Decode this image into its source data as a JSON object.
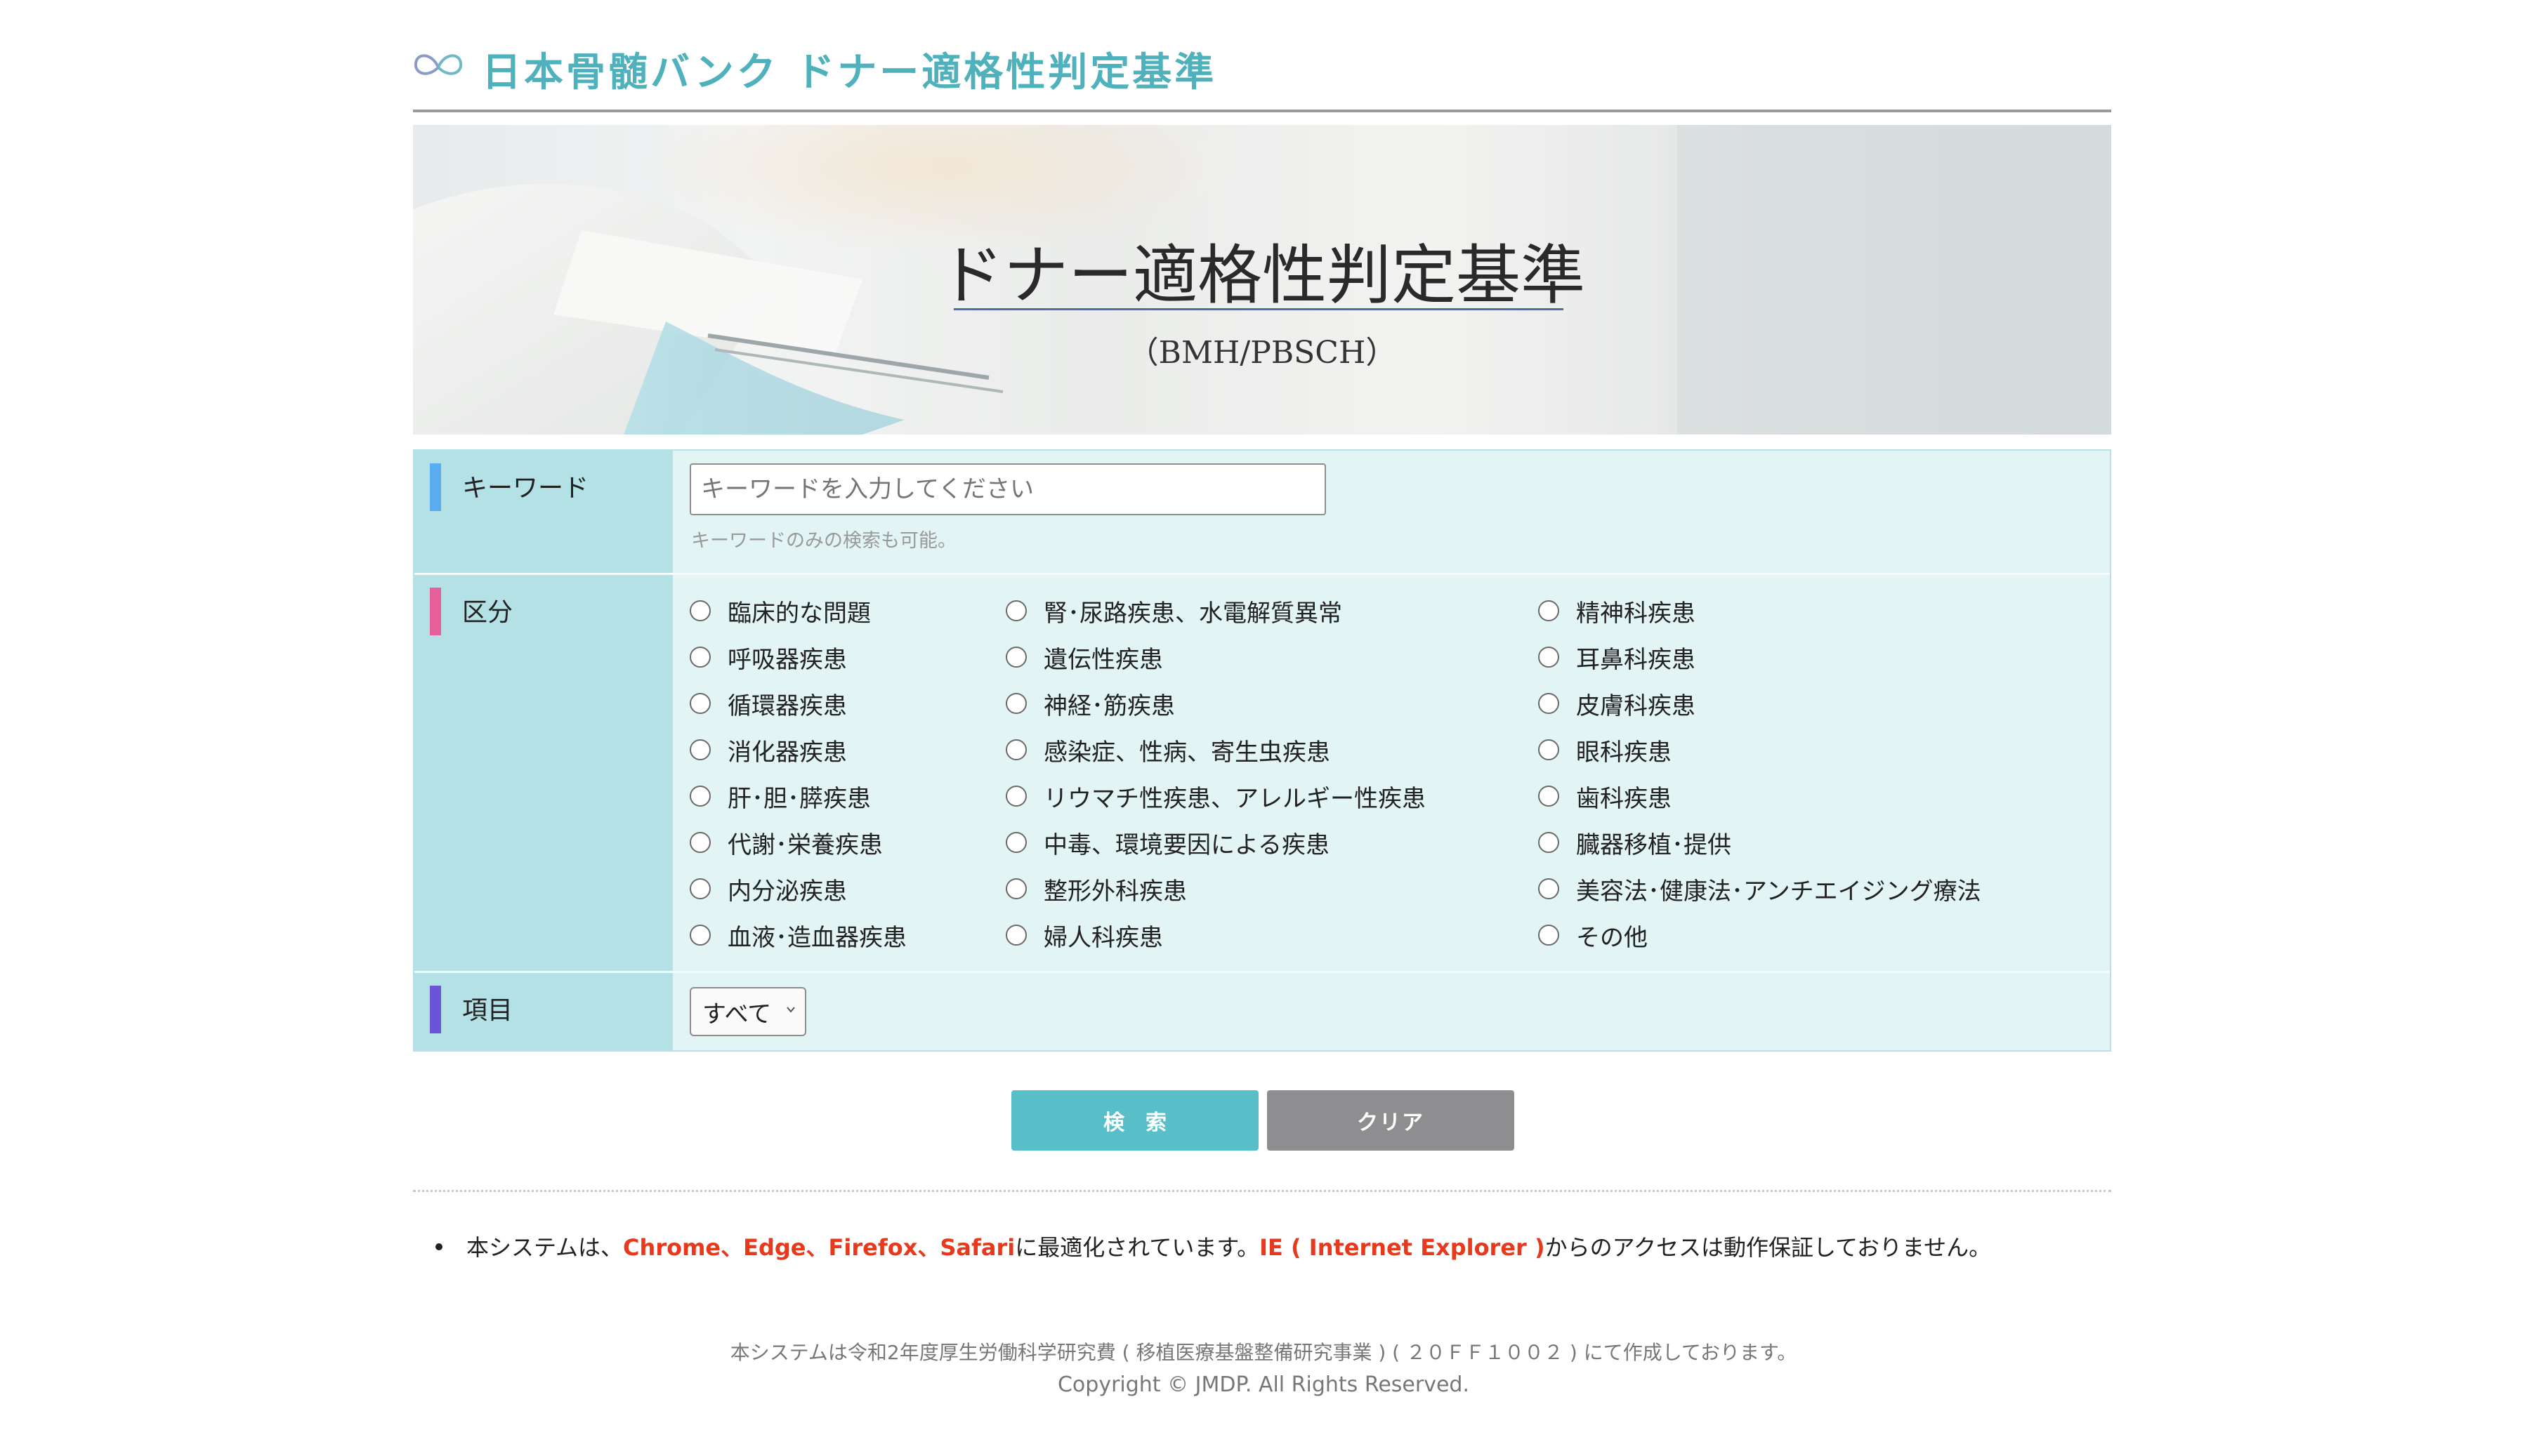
{
  "header": {
    "site_title": "日本骨髄バンク ドナー適格性判定基準"
  },
  "hero": {
    "title": "ドナー適格性判定基準",
    "subtitle": "（BMH/PBSCH）"
  },
  "form": {
    "keyword": {
      "label": "キーワード",
      "placeholder": "キーワードを入力してください",
      "value": "",
      "hint": "キーワードのみの検索も可能。"
    },
    "category": {
      "label": "区分",
      "col1": [
        "臨床的な問題",
        "呼吸器疾患",
        "循環器疾患",
        "消化器疾患",
        "肝･胆･膵疾患",
        "代謝･栄養疾患",
        "内分泌疾患",
        "血液･造血器疾患"
      ],
      "col2": [
        "腎･尿路疾患、水電解質異常",
        "遺伝性疾患",
        "神経･筋疾患",
        "感染症、性病、寄生虫疾患",
        "リウマチ性疾患、アレルギー性疾患",
        "中毒、環境要因による疾患",
        "整形外科疾患",
        "婦人科疾患"
      ],
      "col3": [
        "精神科疾患",
        "耳鼻科疾患",
        "皮膚科疾患",
        "眼科疾患",
        "歯科疾患",
        "臓器移植･提供",
        "美容法･健康法･アンチエイジング療法",
        "その他"
      ]
    },
    "item": {
      "label": "項目",
      "selected": "すべて"
    }
  },
  "buttons": {
    "search": "検索",
    "clear": "クリア"
  },
  "notice": {
    "prefix": "本システムは、",
    "browsers": "Chrome、Edge、Firefox、Safari",
    "middle": "に最適化されています。",
    "ie": "IE ( Internet Explorer )",
    "suffix": "からのアクセスは動作保証しておりません。"
  },
  "footer": {
    "funding": "本システムは令和2年度厚生労働科学研究費 ( 移植医療基盤整備研究事業 ) ( ２０ＦＦ１００２ ) にて作成しております。",
    "copyright": "Copyright © JMDP. All Rights Reserved."
  },
  "colors": {
    "accent": "#4fb1bc",
    "button_search": "#58bfc9",
    "button_clear": "#8e8e90",
    "label_bg": "#b3e1e5",
    "form_bg": "#e2f4f4",
    "bar_keyword": "#5aaef0",
    "bar_category": "#e8609a",
    "bar_item": "#6a55d6",
    "notice_red": "#e8391d"
  }
}
